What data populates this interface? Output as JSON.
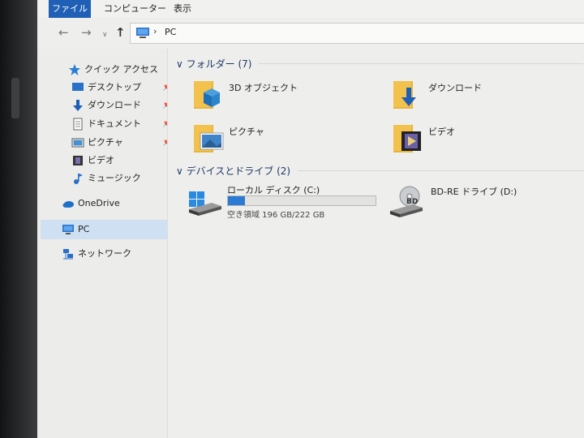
{
  "ribbon": {
    "tabs": [
      "ファイル",
      "コンピューター",
      "表示"
    ]
  },
  "address": {
    "path": "PC"
  },
  "nav": {
    "quick_access": "クイック アクセス",
    "items": [
      {
        "label": "デスクトップ",
        "icon": "desktop-icon",
        "pinned": true
      },
      {
        "label": "ダウンロード",
        "icon": "download-icon",
        "pinned": true
      },
      {
        "label": "ドキュメント",
        "icon": "document-icon",
        "pinned": true
      },
      {
        "label": "ピクチャ",
        "icon": "picture-icon",
        "pinned": true
      },
      {
        "label": "ビデオ",
        "icon": "video-icon",
        "pinned": false
      },
      {
        "label": "ミュージック",
        "icon": "music-icon",
        "pinned": false
      }
    ],
    "onedrive": "OneDrive",
    "pc": "PC",
    "network": "ネットワーク",
    "pin_glyph": "📌"
  },
  "folders": {
    "header": "フォルダー (7)",
    "items": [
      {
        "label": "3D オブジェクト"
      },
      {
        "label": "ダウンロード"
      },
      {
        "label": "ピクチャ"
      },
      {
        "label": "ビデオ"
      }
    ]
  },
  "devices": {
    "header": "デバイスとドライブ (2)",
    "local_disk": {
      "label": "ローカル ディスク (C:)",
      "free_text": "空き領域 196 GB/222 GB",
      "used_fraction": 0.117
    },
    "bd_drive": {
      "label": "BD-RE ドライブ (D:)",
      "disc_text": "BD"
    }
  },
  "colors": {
    "accent": "#1f5fb6",
    "selection": "#cfe0f3",
    "folder": "#f2c24c",
    "drive_bar": "#2b7ad3"
  }
}
